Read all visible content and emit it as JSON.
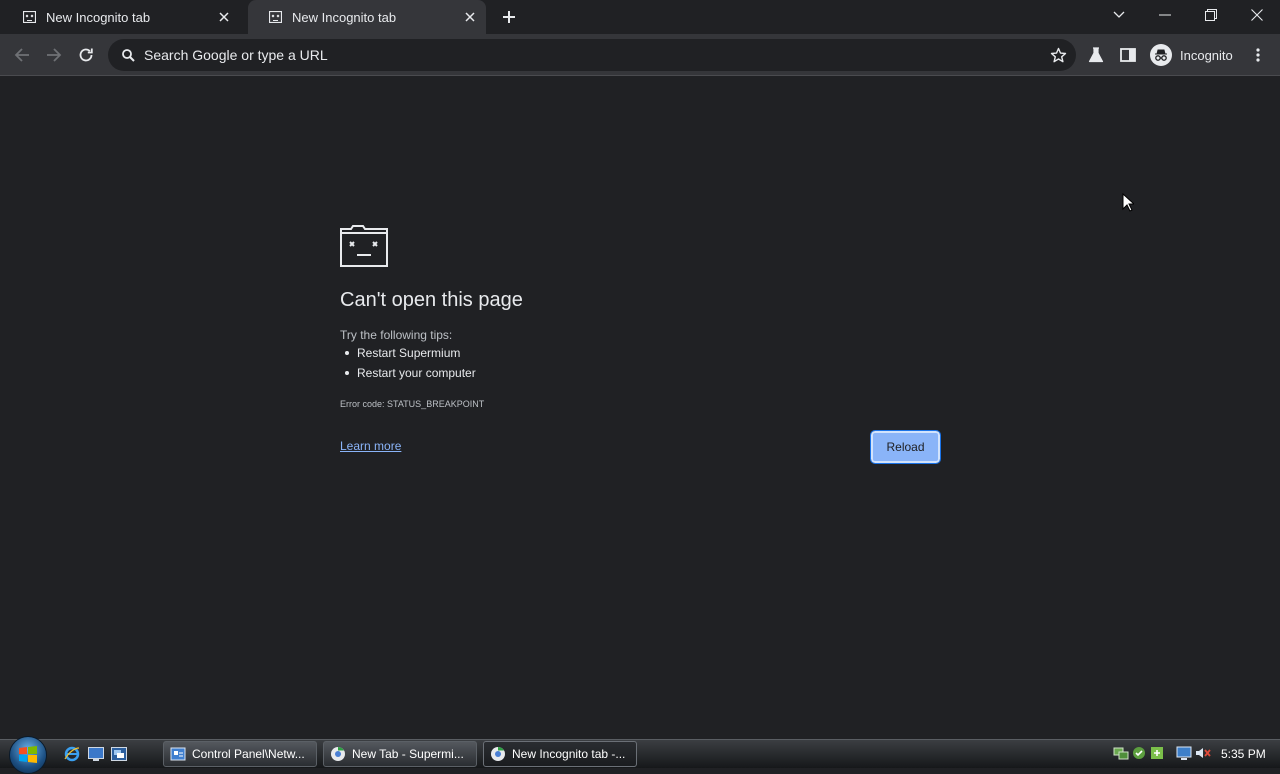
{
  "tabs": [
    {
      "title": "New Incognito tab",
      "active": false
    },
    {
      "title": "New Incognito tab",
      "active": true
    }
  ],
  "toolbar": {
    "omnibox_placeholder": "Search Google or type a URL",
    "profile_label": "Incognito"
  },
  "error_page": {
    "heading": "Can't open this page",
    "tips_label": "Try the following tips:",
    "tips": [
      "Restart Supermium",
      "Restart your computer"
    ],
    "error_code": "Error code: STATUS_BREAKPOINT",
    "learn_more": "Learn more",
    "reload": "Reload"
  },
  "taskbar": {
    "tasks": [
      {
        "label": "Control Panel\\Netw...",
        "icon": "control-panel-icon"
      },
      {
        "label": "New Tab - Supermi...",
        "icon": "supermium-icon"
      },
      {
        "label": "New Incognito tab -...",
        "icon": "supermium-icon",
        "active": true
      }
    ],
    "clock": "5:35 PM"
  },
  "colors": {
    "background": "#202124",
    "toolbar": "#35363a",
    "accent": "#8ab4f8"
  }
}
